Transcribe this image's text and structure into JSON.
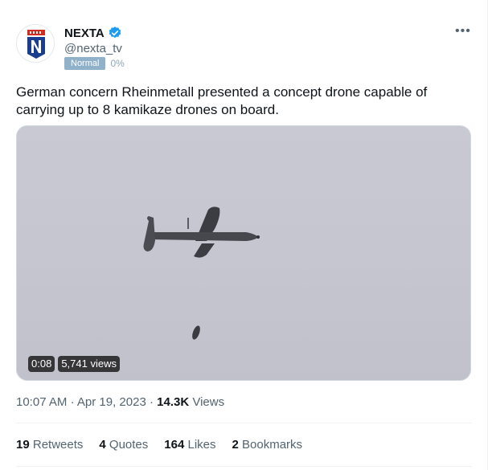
{
  "author": {
    "name": "NEXTA",
    "handle": "@nexta_tv",
    "avatar_icon": "nexta-logo-icon",
    "verified_icon": "verified-badge-icon",
    "label": "Normal",
    "label_percent": "0%"
  },
  "more_icon": "more-options-icon",
  "tweet": {
    "text": "German concern Rheinmetall presented a concept drone capable of carrying up to 8 kamikaze drones on board."
  },
  "media": {
    "duration": "0:08",
    "views": "5,741 views"
  },
  "meta": {
    "time": "10:07 AM",
    "separator1": "·",
    "date": "Apr 19, 2023",
    "separator2": "·",
    "views_count": "14.3K",
    "views_label": "Views"
  },
  "stats": [
    {
      "count": "19",
      "label": "Retweets"
    },
    {
      "count": "4",
      "label": "Quotes"
    },
    {
      "count": "164",
      "label": "Likes"
    },
    {
      "count": "2",
      "label": "Bookmarks"
    }
  ],
  "colors": {
    "accent": "#1d9bf0",
    "brand_red": "#d52b1e",
    "brand_blue": "#1a3d8f"
  }
}
